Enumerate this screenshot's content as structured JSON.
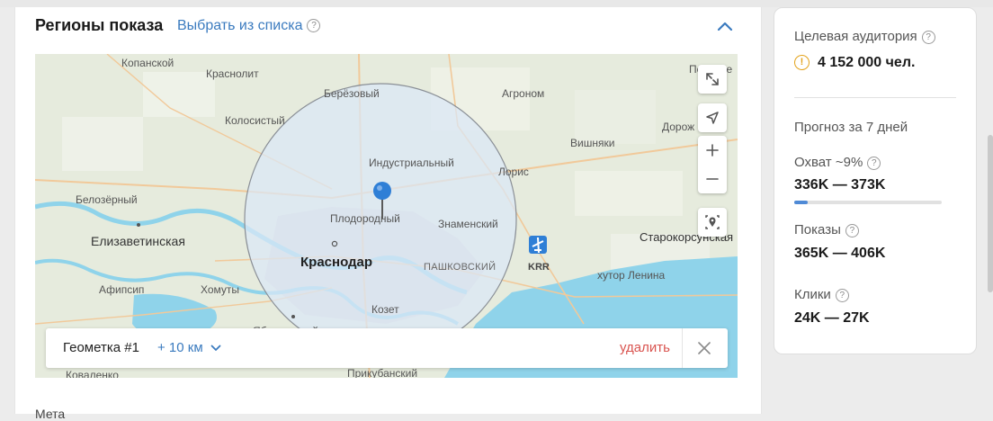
{
  "section": {
    "title": "Регионы показа",
    "choose_link": "Выбрать из списка",
    "help_glyph": "?"
  },
  "map": {
    "places": [
      {
        "key": "kopanskoy",
        "text": "Копанской"
      },
      {
        "key": "krasnolit",
        "text": "Краснолит"
      },
      {
        "key": "berezovy",
        "text": "Берёзовый"
      },
      {
        "key": "agronom",
        "text": "Агроном"
      },
      {
        "key": "pervorech",
        "text": "Перворе"
      },
      {
        "key": "kolosisty",
        "text": "Колосистый"
      },
      {
        "key": "dorozh",
        "text": "Дорож"
      },
      {
        "key": "vishnyaki",
        "text": "Вишняки"
      },
      {
        "key": "industrialny",
        "text": "Индустриальный"
      },
      {
        "key": "loris",
        "text": "Лорис"
      },
      {
        "key": "belozerny",
        "text": "Белозёрный"
      },
      {
        "key": "plodorodny",
        "text": "Плодородный"
      },
      {
        "key": "znamensky",
        "text": "Знаменский"
      },
      {
        "key": "elizavetinskaya",
        "text": "Елизаветинская"
      },
      {
        "key": "starokorsunskaya",
        "text": "Старокорсунская"
      },
      {
        "key": "krasnodar",
        "text": "Краснодар"
      },
      {
        "key": "pashkovsky",
        "text": "ПАШКОВСКИЙ"
      },
      {
        "key": "krr",
        "text": "KRR"
      },
      {
        "key": "khutor_lenina",
        "text": "хутор Ленина"
      },
      {
        "key": "afipsip",
        "text": "Афипсип"
      },
      {
        "key": "khomuty",
        "text": "Хомуты"
      },
      {
        "key": "kozet",
        "text": "Козет"
      },
      {
        "key": "yablonovsky",
        "text": "Яблоновский"
      },
      {
        "key": "prikubansky",
        "text": "Прикубанский"
      },
      {
        "key": "kovalenko",
        "text": "Коваленко"
      }
    ]
  },
  "geometry": {
    "name": "Геометка #1",
    "radius": "+ 10 км",
    "delete_label": "удалить"
  },
  "below_text": "Мета",
  "audience": {
    "label": "Целевая аудитория",
    "value": "4 152 000 чел.",
    "warn_glyph": "!"
  },
  "forecast": {
    "title": "Прогноз за 7 дней",
    "reach_label": "Охват ~9%",
    "reach_value": "336K — 373K",
    "reach_progress": 0.09,
    "impressions_label": "Показы",
    "impressions_value": "365K — 406K",
    "clicks_label": "Клики",
    "clicks_value": "24K — 27K"
  },
  "colors": {
    "link": "#3b7bbf",
    "delete": "#d9534f",
    "warning": "#e3a21a",
    "accent_pin": "#2f7fd6",
    "water": "#8fd3ea",
    "radius_fill": "#dbe8f7"
  }
}
